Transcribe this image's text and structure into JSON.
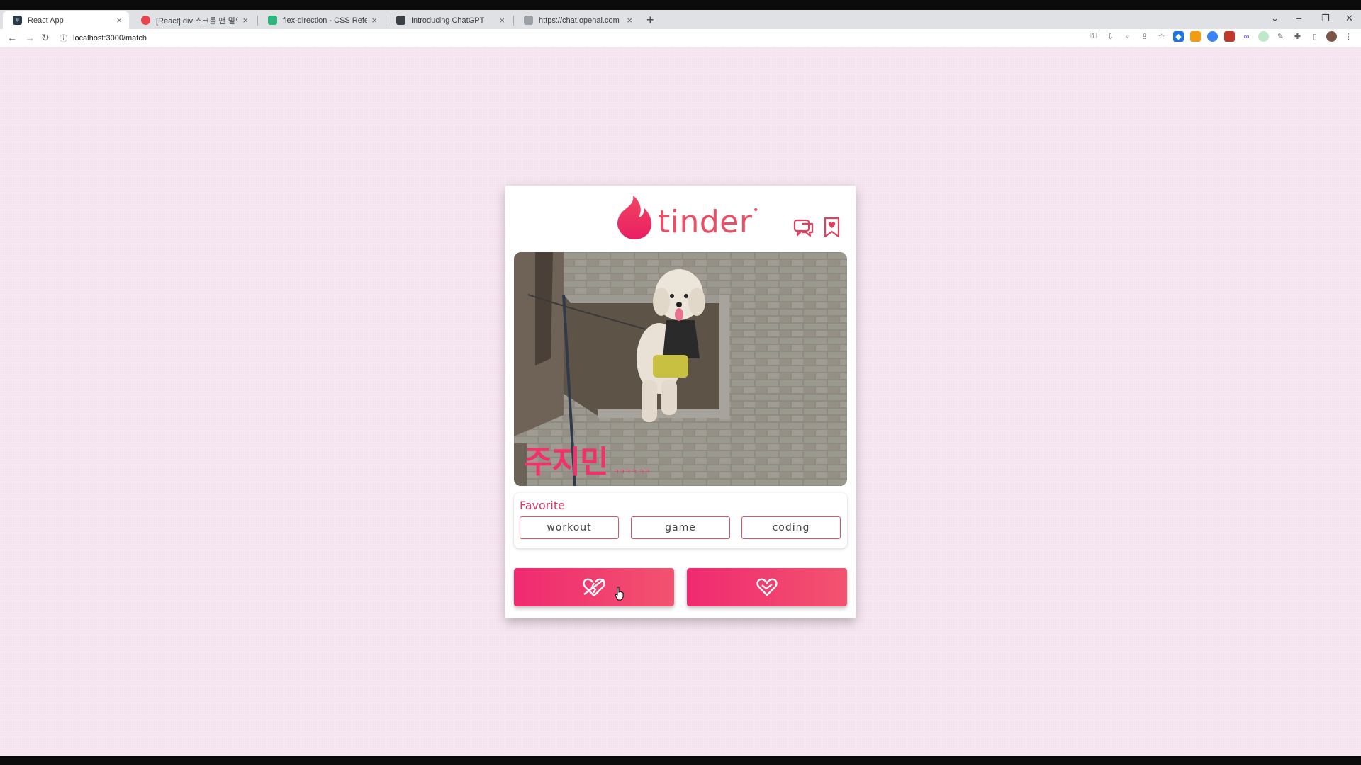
{
  "browser": {
    "tabs": [
      {
        "title": "React App",
        "active": true,
        "favicon": "react-app-icon",
        "favicon_color": "#2b3a4a"
      },
      {
        "title": "[React] div 스크롤 맨 밑으로 내리",
        "active": false,
        "favicon": "velog-icon",
        "favicon_color": "#e8434f"
      },
      {
        "title": "flex-direction - CSS Reference",
        "active": false,
        "favicon": "css-reference-icon",
        "favicon_color": "#2fb67c"
      },
      {
        "title": "Introducing ChatGPT",
        "active": false,
        "favicon": "openai-icon",
        "favicon_color": "#3b3f46"
      },
      {
        "title": "https://chat.openai.com",
        "active": false,
        "favicon": "page-icon",
        "favicon_color": "#9aa0a6"
      }
    ],
    "new_tab_label": "+",
    "url": "localhost:3000/match"
  },
  "app": {
    "brand": "tinder",
    "brand_mark": "•",
    "accent_color": "#ea4f66",
    "header_icons": [
      "chat-icon",
      "bookmark-heart-icon"
    ],
    "profile": {
      "name": "주지민",
      "subtitle": "ㅋㅋㅋㅋ ㅋㅋ"
    },
    "favorite": {
      "title": "Favorite",
      "items": [
        "workout",
        "game",
        "coding"
      ]
    },
    "actions": {
      "pass_icon": "broken-heart-icon",
      "like_icon": "heart-icon",
      "gradient": [
        "#f02a70",
        "#f2536f"
      ]
    }
  }
}
